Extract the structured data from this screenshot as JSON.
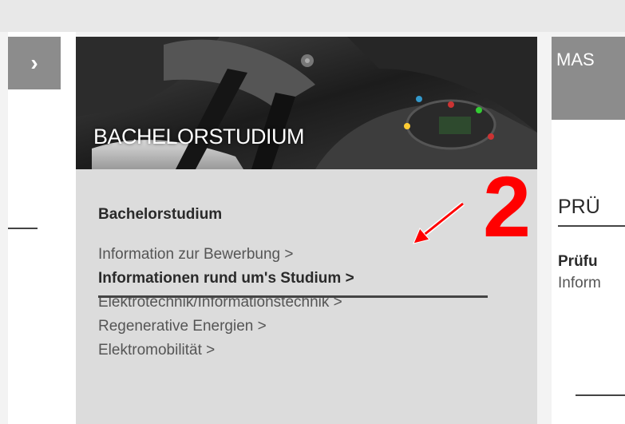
{
  "left_panel": {
    "arrow_glyph": "›"
  },
  "bachelor": {
    "hero_title": "BACHELORSTUDIUM",
    "heading": "Bachelorstudium",
    "links": [
      "Information zur Bewerbung >",
      "Informationen rund um's Studium >",
      "Elektrotechnik/Informationstechnik >",
      "Regenerative Energien >",
      "Elektromobilität >"
    ],
    "active_link_index": 1
  },
  "annotation": {
    "number": "2",
    "color": "#ff0000"
  },
  "master": {
    "hero_title": "MAS",
    "section_heading": "PRÜ",
    "sub_heading": "Prüfu",
    "text": "Inform"
  },
  "colors": {
    "panel_bg": "#dcdcdc",
    "tile_gray": "#8c8c8c",
    "text_dark": "#2a2a2a",
    "text_link": "#555555"
  }
}
